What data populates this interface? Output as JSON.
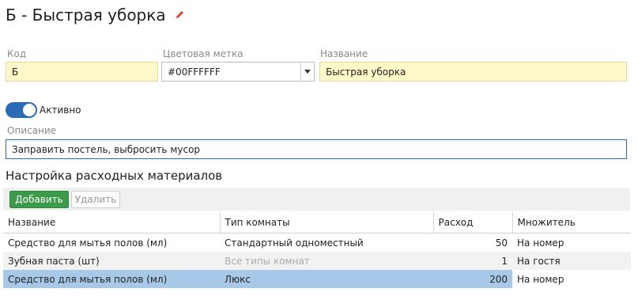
{
  "header": {
    "title": "Б - Быстрая уборка",
    "edit_icon": "pencil-icon",
    "edit_icon_color": "#d9402c"
  },
  "form": {
    "code": {
      "label": "Код",
      "value": "Б"
    },
    "color_tag": {
      "label": "Цветовая метка",
      "value": "#00FFFFFF"
    },
    "name": {
      "label": "Название",
      "value": "Быстрая уборка"
    },
    "active": {
      "label": "Активно",
      "on": true,
      "color": "#2b6cb8"
    },
    "description": {
      "label": "Описание",
      "value": "Заправить постель, выбросить мусор"
    }
  },
  "materials": {
    "title": "Настройка расходных материалов",
    "add_label": "Добавить",
    "delete_label": "Удалить",
    "add_color": "#3a9c4b",
    "columns": [
      "Название",
      "Тип комнаты",
      "Расход",
      "Множитель"
    ],
    "rows": [
      {
        "name": "Средство для мытья полов (мл)",
        "room_type": "Стандартный одноместный",
        "usage": "50",
        "multiplier": "На номер"
      },
      {
        "name": "Зубная паста (шт)",
        "room_type": "Все типы комнат",
        "usage": "1",
        "multiplier": "На гостя"
      },
      {
        "name": "Средство для мытья полов (мл)",
        "room_type": "Люкс",
        "usage": "200",
        "multiplier": "На номер"
      }
    ],
    "selected_color": "#a8c8e8"
  }
}
